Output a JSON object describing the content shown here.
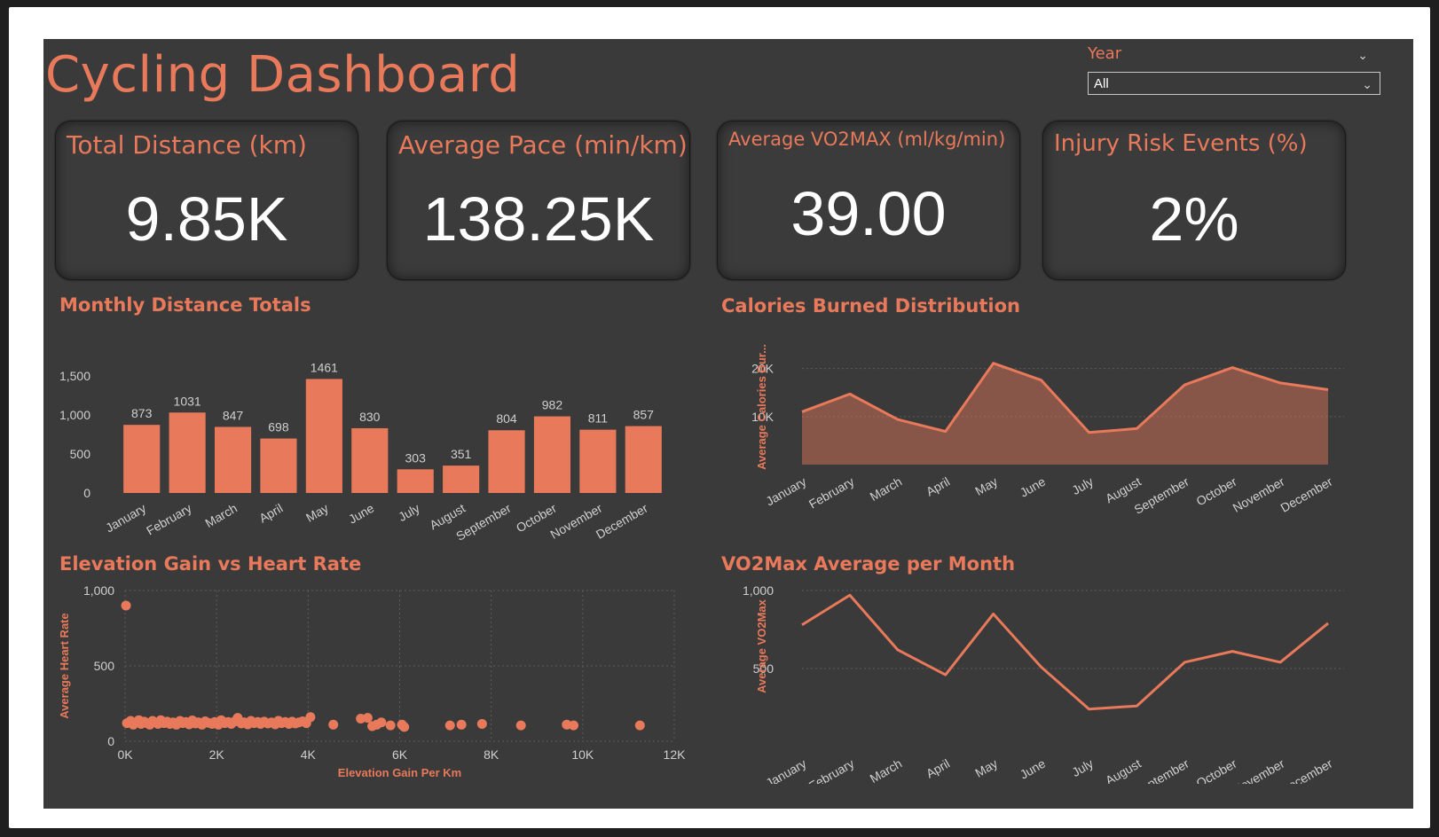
{
  "dashboard": {
    "title": "Cycling Dashboard",
    "accent_color": "#e8795a",
    "background_color": "#3a3a3a"
  },
  "slicer": {
    "label": "Year",
    "selected": "All",
    "collapse_icon": "chevron-down-icon",
    "dropdown_icon": "chevron-down-icon"
  },
  "kpis": [
    {
      "title": "Total Distance (km)",
      "value": "9.85K"
    },
    {
      "title": "Average Pace (min/km)",
      "value": "138.25K"
    },
    {
      "title": "Average VO2MAX (ml/kg/min)",
      "value": "39.00"
    },
    {
      "title": "Injury Risk Events (%)",
      "value": "2%"
    }
  ],
  "chart_data": [
    {
      "id": "monthly-distance",
      "type": "bar",
      "title": "Monthly Distance Totals",
      "categories": [
        "January",
        "February",
        "March",
        "April",
        "May",
        "June",
        "July",
        "August",
        "September",
        "October",
        "November",
        "December"
      ],
      "values": [
        873,
        1031,
        847,
        698,
        1461,
        830,
        303,
        351,
        804,
        982,
        811,
        857
      ],
      "ylim": [
        0,
        1500
      ],
      "yticks": [
        0,
        500,
        1000,
        1500
      ],
      "ytick_labels": [
        "0",
        "500",
        "1,000",
        "1,500"
      ],
      "data_labels": true,
      "color": "#e8795a"
    },
    {
      "id": "calories",
      "type": "area",
      "title": "Calories Burned Distribution",
      "ylabel": "Average Calories Bur...",
      "categories": [
        "January",
        "February",
        "March",
        "April",
        "May",
        "June",
        "July",
        "August",
        "September",
        "October",
        "November",
        "December"
      ],
      "values": [
        11000,
        14700,
        9400,
        6900,
        21100,
        17600,
        6700,
        7500,
        16600,
        20200,
        17000,
        15600
      ],
      "ylim": [
        0,
        24000
      ],
      "yticks": [
        10000,
        20000
      ],
      "ytick_labels": [
        "10K",
        "20K"
      ],
      "grid": true,
      "color": "#e8795a"
    },
    {
      "id": "elevation-hr",
      "type": "scatter",
      "title": "Elevation Gain vs Heart Rate",
      "xlabel": "Elevation Gain Per Km",
      "ylabel": "Average Heart Rate",
      "xlim": [
        0,
        12000
      ],
      "ylim": [
        0,
        1000
      ],
      "xticks": [
        0,
        2000,
        4000,
        6000,
        8000,
        10000,
        12000
      ],
      "xtick_labels": [
        "0K",
        "2K",
        "4K",
        "6K",
        "8K",
        "10K",
        "12K"
      ],
      "yticks": [
        0,
        500,
        1000
      ],
      "ytick_labels": [
        "0",
        "500",
        "1,000"
      ],
      "grid": true,
      "color": "#e8795a",
      "points": [
        [
          20,
          900
        ],
        [
          40,
          120
        ],
        [
          120,
          135
        ],
        [
          180,
          110
        ],
        [
          240,
          125
        ],
        [
          300,
          140
        ],
        [
          350,
          115
        ],
        [
          420,
          130
        ],
        [
          480,
          120
        ],
        [
          540,
          110
        ],
        [
          600,
          135
        ],
        [
          650,
          125
        ],
        [
          720,
          115
        ],
        [
          780,
          140
        ],
        [
          850,
          120
        ],
        [
          920,
          130
        ],
        [
          980,
          115
        ],
        [
          1050,
          125
        ],
        [
          1120,
          110
        ],
        [
          1200,
          135
        ],
        [
          1260,
          120
        ],
        [
          1330,
          128
        ],
        [
          1400,
          112
        ],
        [
          1470,
          138
        ],
        [
          1540,
          118
        ],
        [
          1600,
          126
        ],
        [
          1680,
          110
        ],
        [
          1750,
          132
        ],
        [
          1820,
          122
        ],
        [
          1900,
          115
        ],
        [
          1960,
          128
        ],
        [
          2040,
          110
        ],
        [
          2100,
          140
        ],
        [
          2180,
          120
        ],
        [
          2250,
          128
        ],
        [
          2320,
          115
        ],
        [
          2400,
          132
        ],
        [
          2460,
          155
        ],
        [
          2540,
          118
        ],
        [
          2600,
          126
        ],
        [
          2680,
          112
        ],
        [
          2750,
          135
        ],
        [
          2820,
          120
        ],
        [
          2900,
          128
        ],
        [
          2960,
          115
        ],
        [
          3040,
          130
        ],
        [
          3120,
          118
        ],
        [
          3200,
          125
        ],
        [
          3280,
          112
        ],
        [
          3350,
          136
        ],
        [
          3420,
          120
        ],
        [
          3500,
          128
        ],
        [
          3580,
          115
        ],
        [
          3650,
          130
        ],
        [
          3720,
          118
        ],
        [
          3800,
          125
        ],
        [
          3880,
          132
        ],
        [
          3960,
          120
        ],
        [
          4050,
          160
        ],
        [
          4550,
          110
        ],
        [
          5150,
          150
        ],
        [
          5300,
          155
        ],
        [
          5400,
          100
        ],
        [
          5500,
          110
        ],
        [
          5600,
          125
        ],
        [
          5800,
          105
        ],
        [
          6050,
          110
        ],
        [
          6100,
          95
        ],
        [
          7100,
          105
        ],
        [
          7350,
          110
        ],
        [
          7800,
          115
        ],
        [
          8650,
          105
        ],
        [
          9650,
          110
        ],
        [
          9800,
          105
        ],
        [
          11250,
          105
        ]
      ]
    },
    {
      "id": "vo2max",
      "type": "line",
      "title": "VO2Max Average per Month",
      "ylabel": "Average VO2Max",
      "categories": [
        "January",
        "February",
        "March",
        "April",
        "May",
        "June",
        "July",
        "August",
        "September",
        "October",
        "November",
        "December"
      ],
      "values": [
        780,
        970,
        620,
        460,
        850,
        510,
        240,
        260,
        540,
        610,
        540,
        790
      ],
      "ylim": [
        0,
        1000
      ],
      "yticks": [
        500,
        1000
      ],
      "ytick_labels": [
        "500",
        "1,000"
      ],
      "grid": true,
      "color": "#e8795a"
    }
  ]
}
